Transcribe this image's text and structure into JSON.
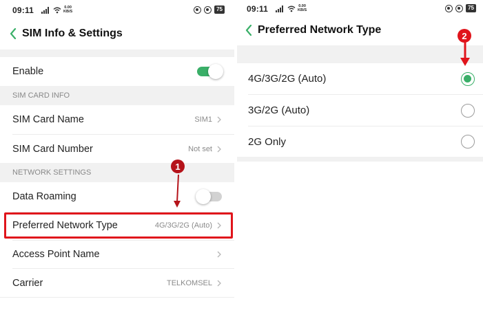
{
  "left": {
    "status": {
      "time": "09:11",
      "speed": "0.00\nKB/S",
      "battery": "75"
    },
    "header": {
      "title": "SIM Info & Settings"
    },
    "enable": {
      "label": "Enable",
      "on": true
    },
    "sim_section": "SIM CARD INFO",
    "sim_card_name": {
      "label": "SIM Card Name",
      "value": "SIM1"
    },
    "sim_card_number": {
      "label": "SIM Card Number",
      "value": "Not set"
    },
    "network_section": "NETWORK SETTINGS",
    "data_roaming": {
      "label": "Data Roaming",
      "on": false
    },
    "preferred_network": {
      "label": "Preferred Network Type",
      "value": "4G/3G/2G (Auto)"
    },
    "apn": {
      "label": "Access Point Name"
    },
    "carrier": {
      "label": "Carrier",
      "value": "TELKOMSEL"
    },
    "step_badge": "1"
  },
  "right": {
    "status": {
      "time": "09:11",
      "speed": "0.00\nKB/S",
      "battery": "75"
    },
    "header": {
      "title": "Preferred Network Type"
    },
    "options": [
      {
        "label": "4G/3G/2G (Auto)",
        "selected": true
      },
      {
        "label": "3G/2G (Auto)",
        "selected": false
      },
      {
        "label": "2G Only",
        "selected": false
      }
    ],
    "step_badge": "2"
  },
  "colors": {
    "accent": "#3aaf68",
    "annotation": "#e0141b"
  },
  "icons": [
    "back-chevron-icon",
    "signal-icon",
    "wifi-icon",
    "chevron-right-icon",
    "alarm-icon",
    "battery-icon",
    "arrow-down-icon"
  ]
}
